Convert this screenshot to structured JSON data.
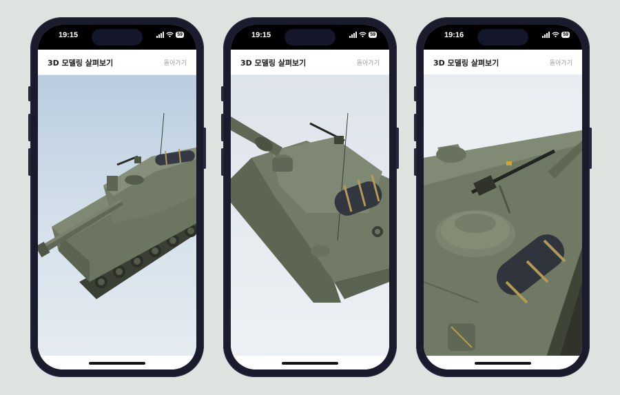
{
  "screens": [
    {
      "status": {
        "time": "19:15",
        "battery": "59"
      },
      "header": {
        "title": "3D 모델링 살펴보기",
        "back_label": "돌아가기"
      },
      "viewer": {
        "subject": "self-propelled howitzer 3D model",
        "view": "left-front overview"
      }
    },
    {
      "status": {
        "time": "19:15",
        "battery": "59"
      },
      "header": {
        "title": "3D 모델링 살펴보기",
        "back_label": "돌아가기"
      },
      "viewer": {
        "subject": "self-propelled howitzer 3D model",
        "view": "top-down angled view"
      }
    },
    {
      "status": {
        "time": "19:16",
        "battery": "59"
      },
      "header": {
        "title": "3D 모델링 살펴보기",
        "back_label": "돌아가기"
      },
      "viewer": {
        "subject": "self-propelled howitzer 3D model",
        "view": "zoomed turret close-up"
      }
    }
  ],
  "colors": {
    "background": "#dfe3df",
    "frame": "#1a1c2e",
    "hull": "#6b7560",
    "sky": "#c5d6e6"
  },
  "icons": [
    "signal-icon",
    "wifi-icon",
    "battery-icon"
  ]
}
